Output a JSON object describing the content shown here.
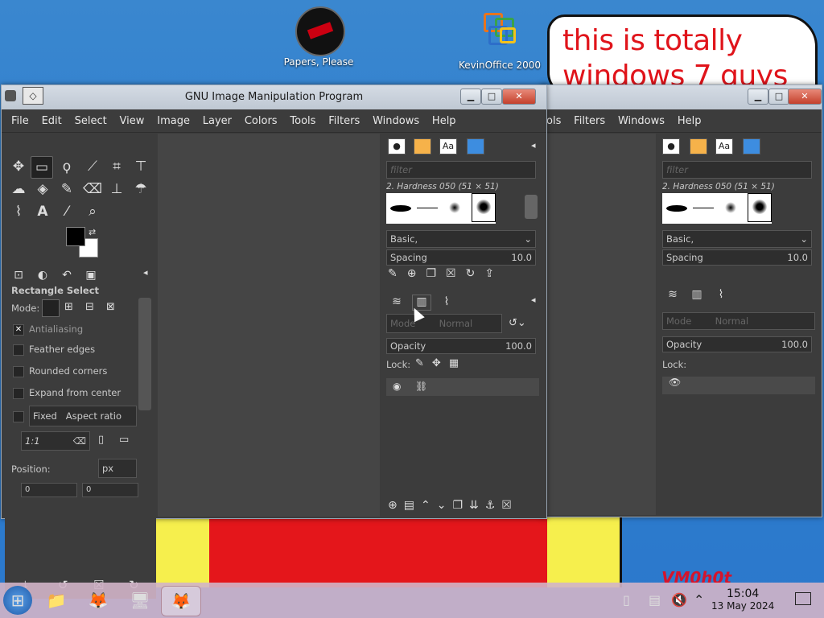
{
  "desktop": {
    "icons": [
      {
        "label": "Papers, Please"
      },
      {
        "label": "KevinOffice 2000"
      }
    ],
    "bubble_text_line1": "this is totally",
    "bubble_text_line2": "windows 7 guys",
    "watermark": "VM0h0t"
  },
  "gimp": {
    "title": "GNU Image Manipulation Program",
    "menu": [
      "File",
      "Edit",
      "Select",
      "View",
      "Image",
      "Layer",
      "Colors",
      "Tools",
      "Filters",
      "Windows",
      "Help"
    ],
    "menu_right": [
      "ols",
      "Filters",
      "Windows",
      "Help"
    ],
    "tool_options": {
      "title": "Rectangle Select",
      "mode_label": "Mode:",
      "antialiasing": "Antialiasing",
      "feather": "Feather edges",
      "rounded": "Rounded corners",
      "expand": "Expand from center",
      "fixed": "Fixed",
      "aspect": "Aspect ratio",
      "ratio_value": "1:1",
      "position_label": "Position:",
      "unit": "px",
      "pos_x": "0",
      "pos_y": "0"
    },
    "brushes": {
      "filter_placeholder": "filter",
      "brush_name": "2. Hardness 050 (51 × 51)",
      "preset": "Basic,",
      "spacing_label": "Spacing",
      "spacing_value": "10.0"
    },
    "layers": {
      "mode_label": "Mode",
      "mode_value": "Normal",
      "opacity_label": "Opacity",
      "opacity_value": "100.0",
      "lock_label": "Lock:"
    }
  },
  "taskbar": {
    "time": "15:04",
    "date": "13 May 2024"
  }
}
